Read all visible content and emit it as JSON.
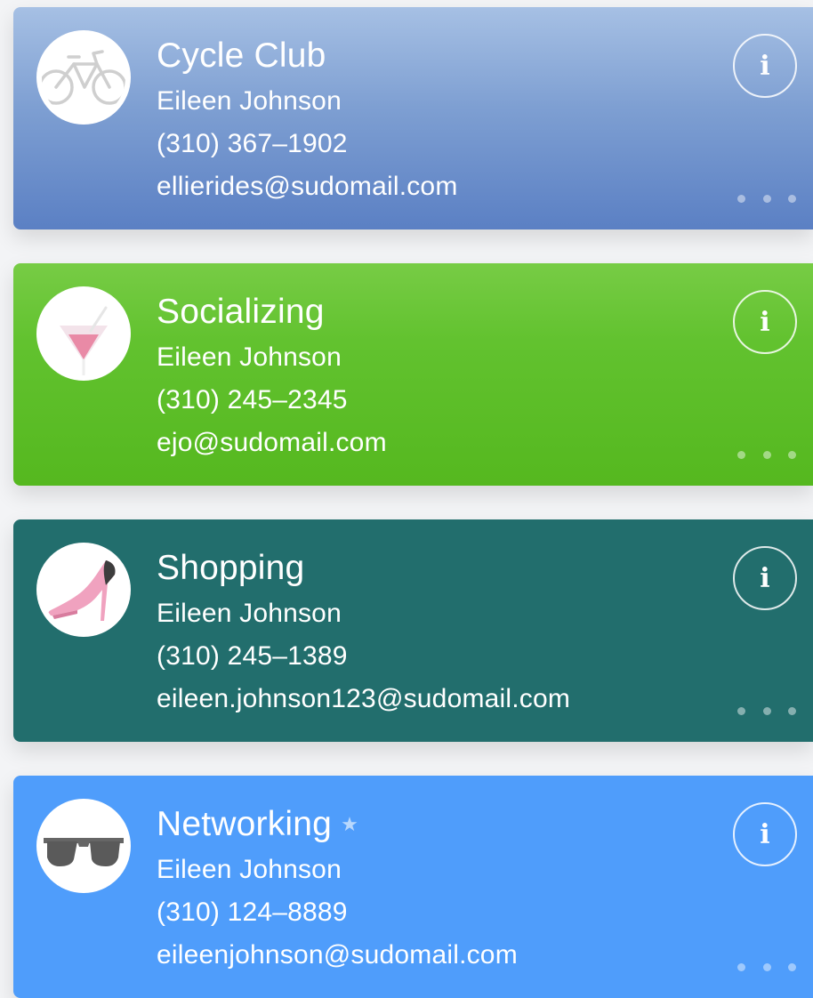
{
  "cards": [
    {
      "title": "Cycle Club",
      "name": "Eileen Johnson",
      "phone": "(310) 367–1902",
      "email": "ellierides@sudomail.com",
      "icon": "bicycle-icon",
      "starred": false,
      "color": "#7e9fd2"
    },
    {
      "title": "Socializing",
      "name": "Eileen Johnson",
      "phone": "(310) 245–2345",
      "email": "ejo@sudomail.com",
      "icon": "cocktail-icon",
      "starred": false,
      "color": "#62c22f"
    },
    {
      "title": "Shopping",
      "name": "Eileen Johnson",
      "phone": "(310) 245–1389",
      "email": "eileen.johnson123@sudomail.com",
      "icon": "high-heel-icon",
      "starred": false,
      "color": "#226e6d"
    },
    {
      "title": "Networking",
      "name": "Eileen Johnson",
      "phone": "(310) 124–8889",
      "email": "eileenjohnson@sudomail.com",
      "icon": "sunglasses-icon",
      "starred": true,
      "star_glyph": "★",
      "color": "#4f9dfb"
    }
  ],
  "info_button_glyph": "i",
  "more_button_icon": "ellipsis-icon"
}
